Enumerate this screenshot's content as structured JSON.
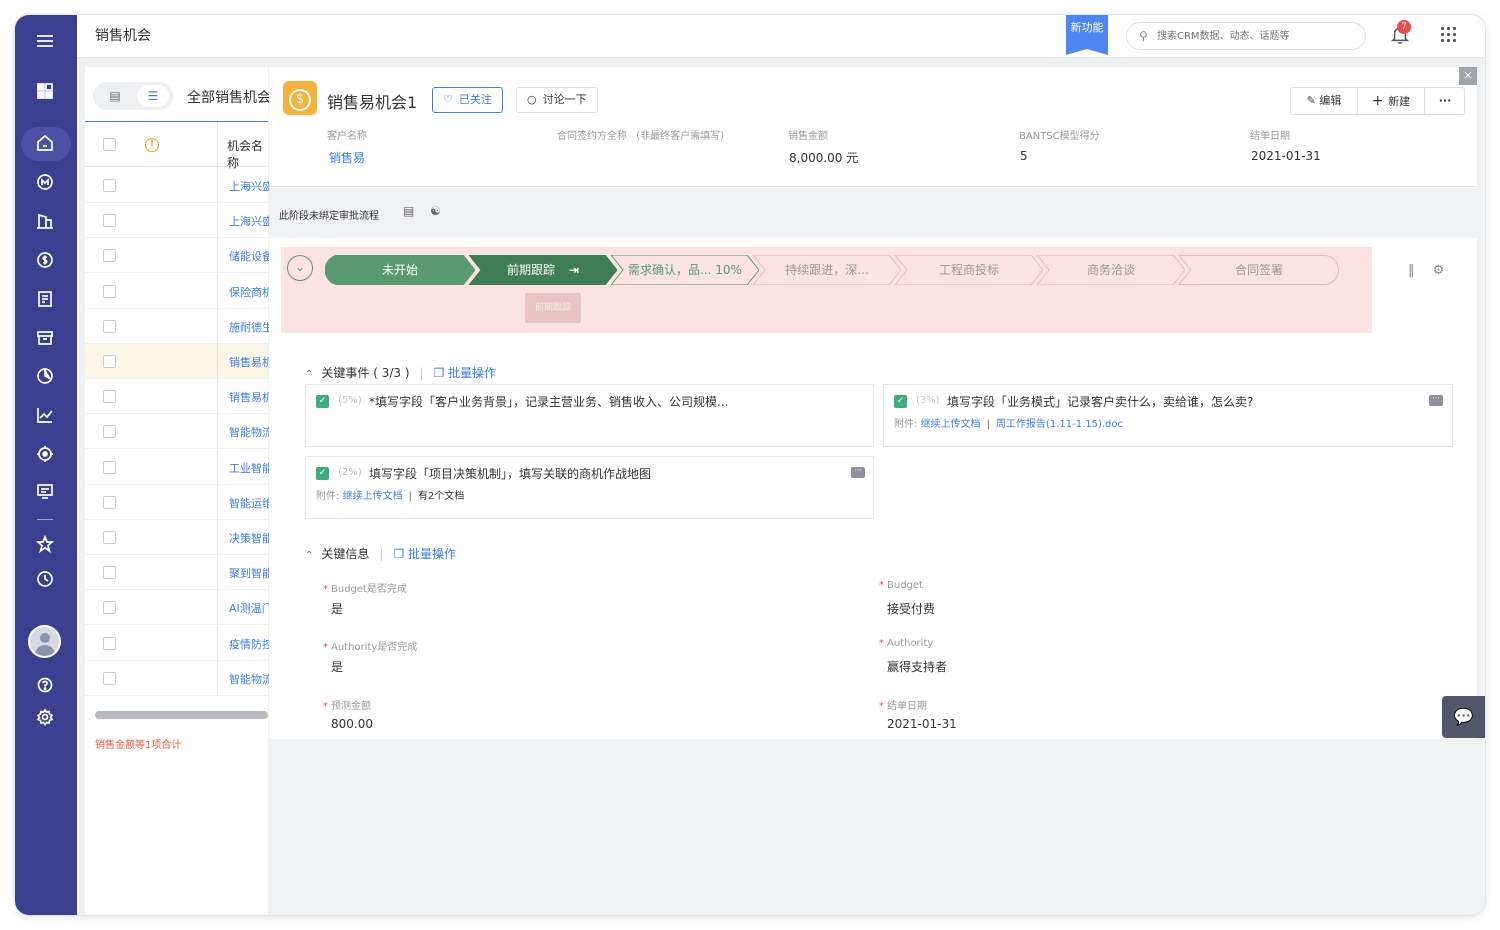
{
  "topbar": {
    "title": "销售机会",
    "new_feature_badge": "新功能",
    "search_placeholder": "搜索CRM数据、动态、话题等",
    "notification_count": "7"
  },
  "sidebar": {
    "icons": [
      "menu-icon",
      "dashboard-icon",
      "home-icon",
      "customer-icon",
      "building-icon",
      "opportunity-icon",
      "contract-icon",
      "archive-icon",
      "pie-chart-icon",
      "line-chart-icon",
      "target-icon",
      "screen-icon",
      "star-icon",
      "clock-icon",
      "help-icon",
      "settings-icon"
    ],
    "active": "home-icon"
  },
  "list": {
    "title": "全部销售机会",
    "column_name": "机会名称",
    "rows": [
      "上海兴盛",
      "上海兴盛",
      "储能设备",
      "保险商机",
      "施耐德生",
      "销售易机",
      "销售易机",
      "智能物流",
      "工业智能",
      "智能运维",
      "决策智能",
      "聚到智能",
      "AI测温门",
      "疫情防控",
      "智能物流"
    ],
    "selected_index": 5,
    "footnote": "销售金额等1项合计"
  },
  "detail": {
    "title": "销售易机会1",
    "follow_label": "已关注",
    "discuss_label": "讨论一下",
    "edit_label": "编辑",
    "new_label": "新建",
    "more_label": "···",
    "fields": [
      {
        "label": "客户名称",
        "value": "销售易"
      },
      {
        "label": "合同签约方全称 （非最终客户需填写）",
        "value": ""
      },
      {
        "label": "销售金额",
        "value": "8,000.00 元"
      },
      {
        "label": "BANTSC模型得分",
        "value": "5"
      },
      {
        "label": "结单日期",
        "value": "2021-01-31"
      }
    ],
    "approval_text": "此阶段未绑定审批流程",
    "stages": [
      {
        "label": "未开始",
        "state": "done"
      },
      {
        "label": "前期跟踪",
        "state": "current"
      },
      {
        "label": "需求确认，品... 10%",
        "state": "next"
      },
      {
        "label": "持续跟进，深...",
        "state": "future"
      },
      {
        "label": "工程商投标",
        "state": "future"
      },
      {
        "label": "商务洽谈",
        "state": "future"
      },
      {
        "label": "合同签署",
        "state": "future"
      }
    ],
    "stage_tooltip": "前期跟踪",
    "key_events": {
      "title": "关键事件 ( 3/3 )",
      "batch": "批量操作",
      "items": [
        {
          "pct": "(5%)",
          "text": "*填写字段「客户业务背景」，记录主营业务、销售收入、公司规模...",
          "attach_label": "",
          "attach_link": "",
          "attach_extra": ""
        },
        {
          "pct": "(3%)",
          "text": "填写字段「业务模式」记录客户卖什么，卖给谁，怎么卖?",
          "attach_label": "附件:",
          "attach_link": "继续上传文档",
          "attach_extra": "周工作报告(1.11-1.15).doc"
        },
        {
          "pct": "(2%)",
          "text": "填写字段「项目决策机制」，填写关联的商机作战地图",
          "attach_label": "附件:",
          "attach_link": "继续上传文档",
          "attach_extra": "有2个文档"
        }
      ]
    },
    "key_info": {
      "title": "关键信息",
      "batch": "批量操作",
      "fields": [
        {
          "label": "Budget是否完成",
          "value": "是"
        },
        {
          "label": "Budget",
          "value": "接受付费"
        },
        {
          "label": "Authority是否完成",
          "value": "是"
        },
        {
          "label": "Authority",
          "value": "赢得支持者"
        },
        {
          "label": "预测金额",
          "value": "800.00"
        },
        {
          "label": "结单日期",
          "value": "2021-01-31"
        }
      ]
    }
  },
  "colors": {
    "sidebar": "#3b3f8f",
    "accent": "#3d7ef0",
    "stage_done": "#5a9a70",
    "stage_current": "#3f7d57",
    "stage_area": "#fbe3e3"
  }
}
